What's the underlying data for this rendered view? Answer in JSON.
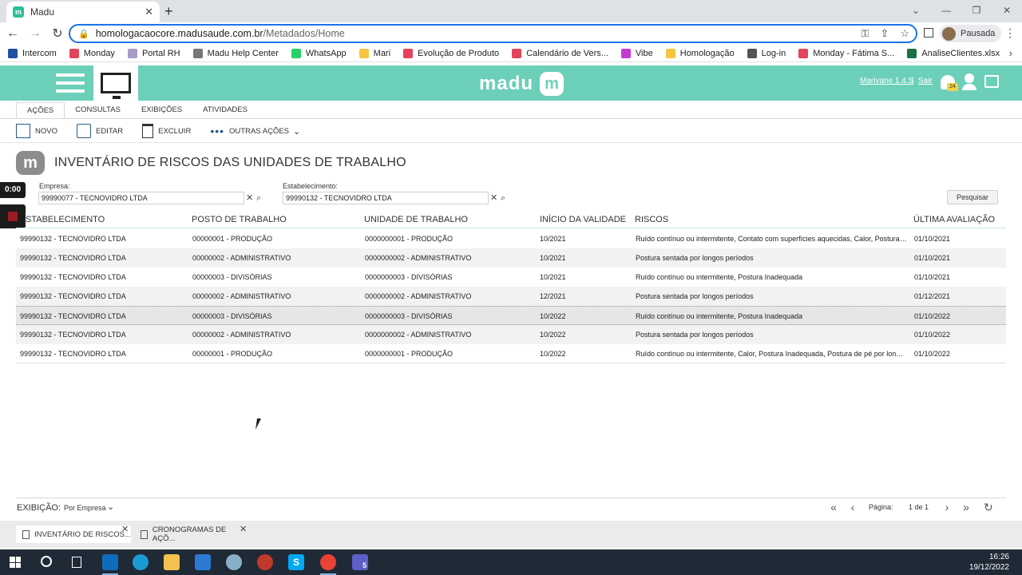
{
  "browser": {
    "tab_title": "Madu",
    "tab_favicon": "m",
    "new_tab": "+",
    "url_host": "homologacaocore.madusaude.com.br",
    "url_path": "/Metadados/Home",
    "profile_status": "Pausada",
    "bookmarks": [
      {
        "label": "Intercom",
        "icon_color": "#1f4fa3"
      },
      {
        "label": "Monday",
        "icon_color": "#e2445c"
      },
      {
        "label": "Portal RH",
        "icon_color": "#a89cc8"
      },
      {
        "label": "Madu Help Center",
        "icon_color": "#777777"
      },
      {
        "label": "WhatsApp",
        "icon_color": "#25d366"
      },
      {
        "label": "Mari",
        "icon_color": "#f5c542"
      },
      {
        "label": "Evolução de Produto",
        "icon_color": "#e2445c"
      },
      {
        "label": "Calendário de Vers...",
        "icon_color": "#e2445c"
      },
      {
        "label": "Vibe",
        "icon_color": "#c43bd4"
      },
      {
        "label": "Homologação",
        "icon_color": "#f5c542"
      },
      {
        "label": "Log-in",
        "icon_color": "#555555"
      },
      {
        "label": "Monday - Fátima S...",
        "icon_color": "#e2445c"
      },
      {
        "label": "AnaliseClientes.xlsx",
        "icon_color": "#1d7044"
      }
    ]
  },
  "app": {
    "brand": "madu",
    "brand_mark": "m",
    "user": "Marivane 1.4.5",
    "separator": "|",
    "logout": "Sair",
    "notifications_count": "24",
    "accent_color": "#6ccfb9",
    "menu_tabs": [
      "AÇÕES",
      "CONSULTAS",
      "EXIBIÇÕES",
      "ATIVIDADES"
    ],
    "actions": {
      "new": "NOVO",
      "edit": "EDITAR",
      "delete": "EXCLUIR",
      "more": "OUTRAS AÇÕES"
    },
    "page_title": "INVENTÁRIO DE RISCOS DAS UNIDADES DE TRABALHO"
  },
  "recorder": {
    "timer": "0:00"
  },
  "filters": {
    "company_label": "Empresa:",
    "company_value": "99990077 - TECNOVIDRO LTDA",
    "establishment_label": "Estabelecimento:",
    "establishment_value": "99990132 - TECNOVIDRO LTDA",
    "search_button": "Pesquisar"
  },
  "table": {
    "columns": [
      "STABELECIMENTO",
      "POSTO DE TRABALHO",
      "UNIDADE DE TRABALHO",
      "INÍCIO DA VALIDADE",
      "RISCOS",
      "ÚLTIMA AVALIAÇÃO"
    ],
    "rows": [
      [
        "99990132 - TECNOVIDRO LTDA",
        "00000001 - PRODUÇÃO",
        "0000000001 - PRODUÇÃO",
        "10/2021",
        "Ruído contínuo ou intermitente, Contato com superfícies aquecidas, Calor, Postura In...",
        "01/10/2021"
      ],
      [
        "99990132 - TECNOVIDRO LTDA",
        "00000002 - ADMINISTRATIVO",
        "0000000002 - ADMINISTRATIVO",
        "10/2021",
        "Postura sentada por longos períodos",
        "01/10/2021"
      ],
      [
        "99990132 - TECNOVIDRO LTDA",
        "00000003 - DIVISÓRIAS",
        "0000000003 - DIVISÓRIAS",
        "10/2021",
        "Ruído contínuo ou intermitente, Postura Inadequada",
        "01/10/2021"
      ],
      [
        "99990132 - TECNOVIDRO LTDA",
        "00000002 - ADMINISTRATIVO",
        "0000000002 - ADMINISTRATIVO",
        "12/2021",
        "Postura sentada por longos períodos",
        "01/12/2021"
      ],
      [
        "99990132 - TECNOVIDRO LTDA",
        "00000003 - DIVISÓRIAS",
        "0000000003 - DIVISÓRIAS",
        "10/2022",
        "Ruído contínuo ou intermitente, Postura Inadequada",
        "01/10/2022"
      ],
      [
        "99990132 - TECNOVIDRO LTDA",
        "00000002 - ADMINISTRATIVO",
        "0000000002 - ADMINISTRATIVO",
        "10/2022",
        "Postura sentada por longos períodos",
        "01/10/2022"
      ],
      [
        "99990132 - TECNOVIDRO LTDA",
        "00000001 - PRODUÇÃO",
        "0000000001 - PRODUÇÃO",
        "10/2022",
        "Ruído contínuo ou intermitente, Calor, Postura Inadequada, Postura de pé por longos...",
        "01/10/2022"
      ]
    ]
  },
  "footer": {
    "view_label": "EXIBIÇÃO:",
    "view_value": "Por Empresa",
    "page_label": "Página:",
    "page_count": "1 de 1"
  },
  "open_docs": [
    {
      "label": "INVENTÁRIO DE RISCOS..."
    },
    {
      "label": "CRONOGRAMAS DE AÇÕ..."
    }
  ],
  "taskbar": {
    "time": "16:26",
    "date": "19/12/2022",
    "teams_badge": "5"
  }
}
